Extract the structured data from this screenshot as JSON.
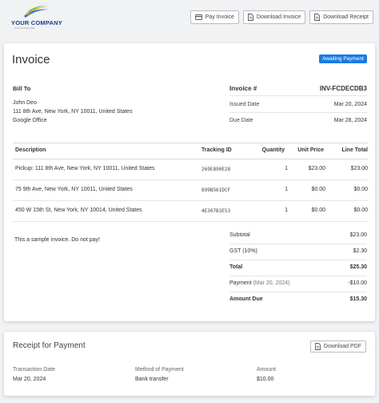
{
  "company": {
    "name": "YOUR COMPANY",
    "tagline": "SLOGAN GOES HERE"
  },
  "actions": {
    "pay": {
      "label": "Pay Invoice",
      "icon": "credit-card-icon"
    },
    "download_invoice": {
      "label": "Download Invoice",
      "icon": "document-icon"
    },
    "download_receipt": {
      "label": "Download Receipt",
      "icon": "document-icon"
    }
  },
  "invoice": {
    "title": "Invoice",
    "status": "Awaiting Payment",
    "status_color": "#1a7be0",
    "bill_to": {
      "heading": "Bill To",
      "name": "John Deo",
      "address": "111 8th Ave, New York, NY 10011, United States",
      "office": "Google Office"
    },
    "number_label": "Invoice #",
    "number": "INV-FCDECDB3",
    "issued_label": "Issued Date",
    "issued": "Mar 20, 2024",
    "due_label": "Due Date",
    "due": "Mar 28, 2024"
  },
  "table": {
    "headers": {
      "description": "Description",
      "tracking": "Tracking ID",
      "quantity": "Quantity",
      "unit_price": "Unit Price",
      "line_total": "Line Total"
    },
    "rows": [
      {
        "description": "Pickup: 111 8th Ave, New York, NY 10011, United States",
        "tracking": "269E890E28",
        "quantity": "1",
        "unit_price": "$23.00",
        "line_total": "$23.00"
      },
      {
        "description": "75 9th Ave, New York, NY 10011, United States",
        "tracking": "899B561DCF",
        "quantity": "1",
        "unit_price": "$0.00",
        "line_total": "$0.00"
      },
      {
        "description": "450 W 15th St, New York, NY 10014, United States",
        "tracking": "4E307B3E53",
        "quantity": "1",
        "unit_price": "$0.00",
        "line_total": "$0.00"
      }
    ]
  },
  "note": "This a sample invoice. Do not pay!",
  "summary": {
    "subtotal_label": "Subtotal",
    "subtotal": "$23.00",
    "gst_label": "GST (10%)",
    "gst": "$2.30",
    "total_label": "Total",
    "total": "$25.30",
    "payment_label": "Payment",
    "payment_date": "(Mar 20, 2024)",
    "payment": "-$10.00",
    "amount_due_label": "Amount Due",
    "amount_due": "$15.30"
  },
  "receipt": {
    "title": "Receipt for Payment",
    "download_pdf": "Download PDF",
    "transaction_date_label": "Transaction Date",
    "transaction_date": "Mar 20, 2024",
    "method_label": "Method of Payment",
    "method": "Bank transfer",
    "amount_label": "Amount",
    "amount": "$10.00"
  }
}
